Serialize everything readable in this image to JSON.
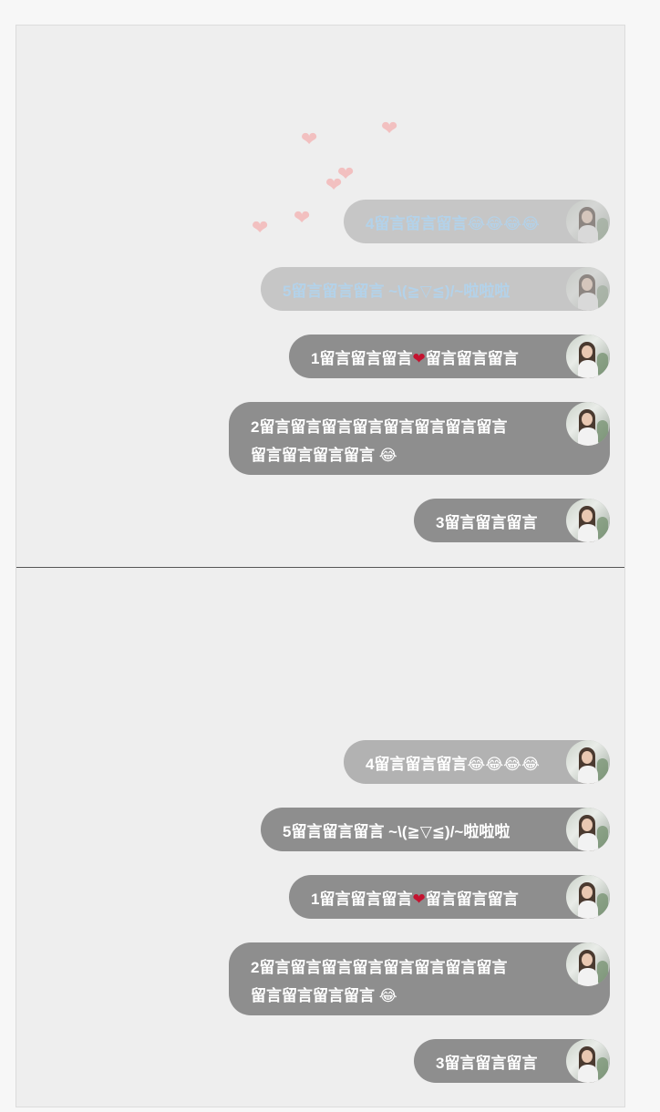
{
  "panels": {
    "top": {
      "messages": [
        {
          "id": 4,
          "text": "4留言留言留言😂😂😂😂"
        },
        {
          "id": 5,
          "text": "5留言留言留言 ~\\(≧▽≦)/~啦啦啦"
        },
        {
          "id": 1,
          "text_before": "1留言留言留言",
          "heart": "❤",
          "text_after": "留言留言留言"
        },
        {
          "id": 2,
          "line1": "2留言留言留言留言留言留言留言留言",
          "line2": "留言留言留言留言 😂"
        },
        {
          "id": 3,
          "text": "3留言留言留言"
        }
      ],
      "floating_heart_glyph": "❤"
    },
    "bottom": {
      "messages": [
        {
          "id": 4,
          "text": "4留言留言留言😂😂😂😂"
        },
        {
          "id": 5,
          "text": "5留言留言留言 ~\\(≧▽≦)/~啦啦啦"
        },
        {
          "id": 1,
          "text_before": "1留言留言留言",
          "heart": "❤",
          "text_after": "留言留言留言"
        },
        {
          "id": 2,
          "line1": "2留言留言留言留言留言留言留言留言",
          "line2": "留言留言留言留言 😂"
        },
        {
          "id": 3,
          "text": "3留言留言留言"
        }
      ]
    }
  },
  "colors": {
    "bubble_dark": "#8e8e8e",
    "bubble_light": "#b2b2b2",
    "bubble_faded": "#c6c6c6",
    "faded_text": "#b3d2ea",
    "heart_pink": "#f3b8b8",
    "heart_red": "#c4122f"
  },
  "icons": {
    "avatar": "user-avatar-photo",
    "floating_heart": "heart-icon"
  }
}
